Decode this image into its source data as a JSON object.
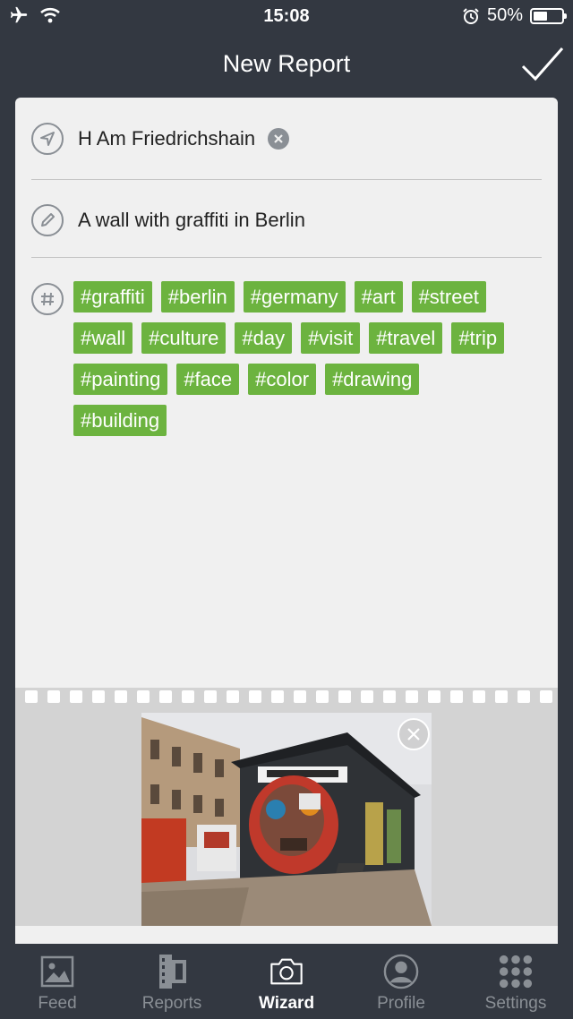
{
  "status_bar": {
    "time": "15:08",
    "battery_percent": "50%",
    "battery_level": 0.5
  },
  "nav": {
    "title": "New Report"
  },
  "report": {
    "location": "H Am Friedrichshain",
    "description": "A wall with graffiti in Berlin",
    "tags": [
      "#graffiti",
      "#berlin",
      "#germany",
      "#art",
      "#street",
      "#wall",
      "#culture",
      "#day",
      "#visit",
      "#travel",
      "#trip",
      "#painting",
      "#face",
      "#color",
      "#drawing",
      "#building"
    ]
  },
  "tabs": [
    {
      "label": "Feed",
      "icon": "image-icon",
      "active": false
    },
    {
      "label": "Reports",
      "icon": "film-icon",
      "active": false
    },
    {
      "label": "Wizard",
      "icon": "camera-icon",
      "active": true
    },
    {
      "label": "Profile",
      "icon": "user-icon",
      "active": false
    },
    {
      "label": "Settings",
      "icon": "grid-dots-icon",
      "active": false
    }
  ],
  "colors": {
    "background": "#333841",
    "card": "#f0f0f0",
    "tag": "#6cb33f",
    "icon_gray": "#8a8f95"
  }
}
